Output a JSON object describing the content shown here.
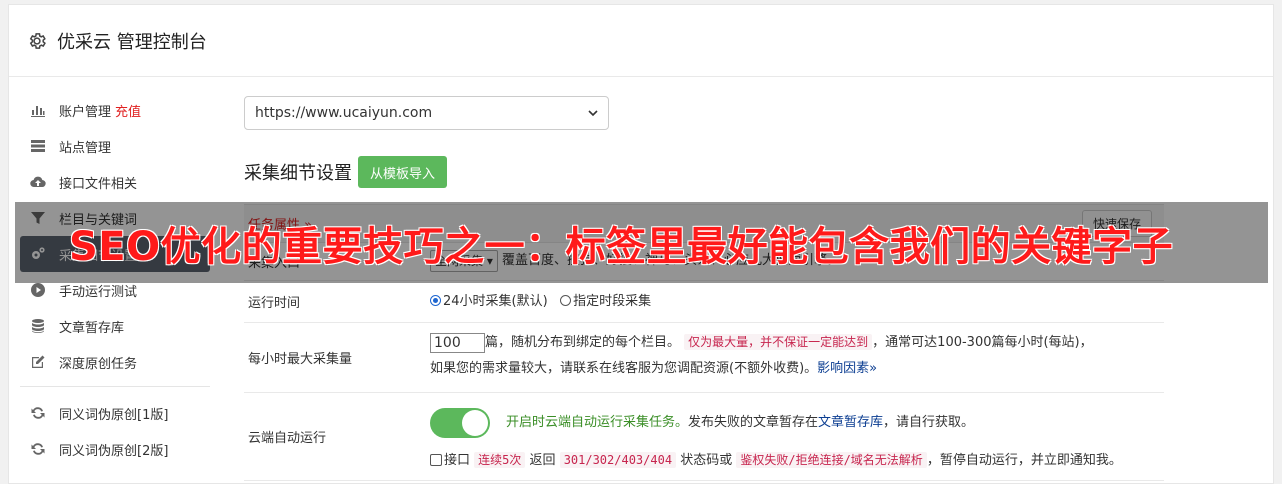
{
  "header": {
    "title": "优采云 管理控制台"
  },
  "sidebar": {
    "items": [
      {
        "label": "账户管理",
        "extra": "充值",
        "icon": "bar-chart-icon"
      },
      {
        "label": "站点管理",
        "icon": "server-icon"
      },
      {
        "label": "接口文件相关",
        "icon": "cloud-upload-icon"
      },
      {
        "label": "栏目与关键词",
        "icon": "filter-icon"
      },
      {
        "label": "采集细节设置",
        "icon": "cogs-icon",
        "active": true
      },
      {
        "label": "手动运行测试",
        "icon": "play-circle-icon"
      },
      {
        "label": "文章暂存库",
        "icon": "database-icon"
      },
      {
        "label": "深度原创任务",
        "icon": "edit-icon"
      }
    ],
    "extra_items": [
      {
        "label": "同义词伪原创[1版]",
        "icon": "refresh-icon"
      },
      {
        "label": "同义词伪原创[2版]",
        "icon": "refresh-icon"
      }
    ]
  },
  "main": {
    "url_select": {
      "value": "https://www.ucaiyun.com"
    },
    "section_title": "采集细节设置",
    "import_button": "从模板导入",
    "table": {
      "head_label": "任务属性 »",
      "quick_save": "快速保存",
      "rows": {
        "scope": {
          "label": "采集入口",
          "select": "全网采集",
          "desc": "覆盖百度、搜狗、好搜、神马、头条、必应几大搜索引擎。"
        },
        "runtime": {
          "label": "运行时间",
          "opt1": "24小时采集(默认)",
          "opt2": "指定时段采集"
        },
        "max_per_hour": {
          "label": "每小时最大采集量",
          "value": "100",
          "text1": "篇，随机分布到绑定的每个栏目。",
          "tag1": "仅为最大量，并不保证一定能达到",
          "text2": "，通常可达100-300篇每小时(每站)，",
          "text3": "如果您的需求量较大，请联系在线客服为您调配资源(不额外收费)。",
          "link": "影响因素",
          "link_chevron": "»"
        },
        "cloud_auto": {
          "label": "云端自动运行",
          "enabled_text": "开启时云端自动运行采集任务。",
          "text1": "发布失败的文章暂存在",
          "link": "文章暂存库",
          "text2": "，请自行获取。",
          "cb_label": "接口",
          "tag1": "连续5次",
          "text3": "返回",
          "tag2": "301/302/403/404",
          "text4": "状态码或",
          "tag3": "鉴权失败/拒绝连接/域名无法解析",
          "text5": "，暂停自动运行，并立即通知我。"
        }
      }
    }
  },
  "overlay": {
    "headline": "SEO优化的重要技巧之一：标签里最好能包含我们的关键字子"
  },
  "colors": {
    "accent_green": "#5cb85c",
    "active_sidebar": "#5c6470",
    "red_text": "#e02020",
    "link_blue": "#0b3d91"
  }
}
